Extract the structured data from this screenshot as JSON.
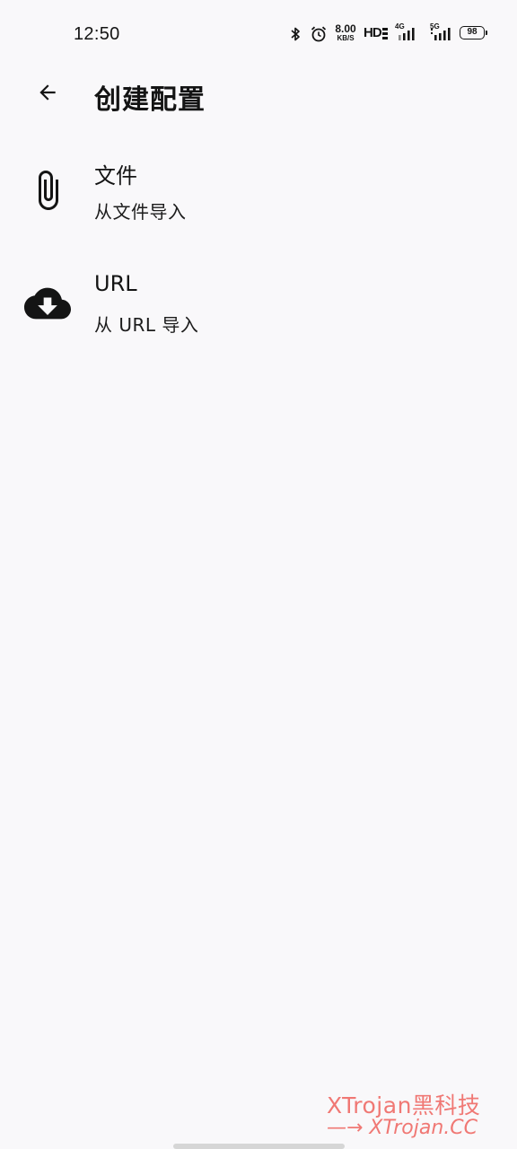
{
  "status_bar": {
    "time": "12:50",
    "net_speed_value": "8.00",
    "net_speed_unit": "KB/S",
    "hd_label": "HD",
    "sim1_tag": "4G",
    "sim2_tag": "5G",
    "battery": "98",
    "icons": [
      "bluetooth-icon",
      "alarm-icon",
      "signal-icon",
      "signal-icon"
    ]
  },
  "header": {
    "title": "创建配置",
    "back_icon": "arrow-left-icon"
  },
  "options": [
    {
      "icon": "paperclip-icon",
      "title": "文件",
      "subtitle": "从文件导入"
    },
    {
      "icon": "cloud-download-icon",
      "title": "URL",
      "subtitle": "从 URL 导入"
    }
  ],
  "watermark": {
    "line1": "XTrojan黑科技",
    "line2": "—→ XTrojan.CC"
  },
  "colors": {
    "background": "#f9f8fa",
    "text": "#141414",
    "watermark": "#f07874"
  }
}
